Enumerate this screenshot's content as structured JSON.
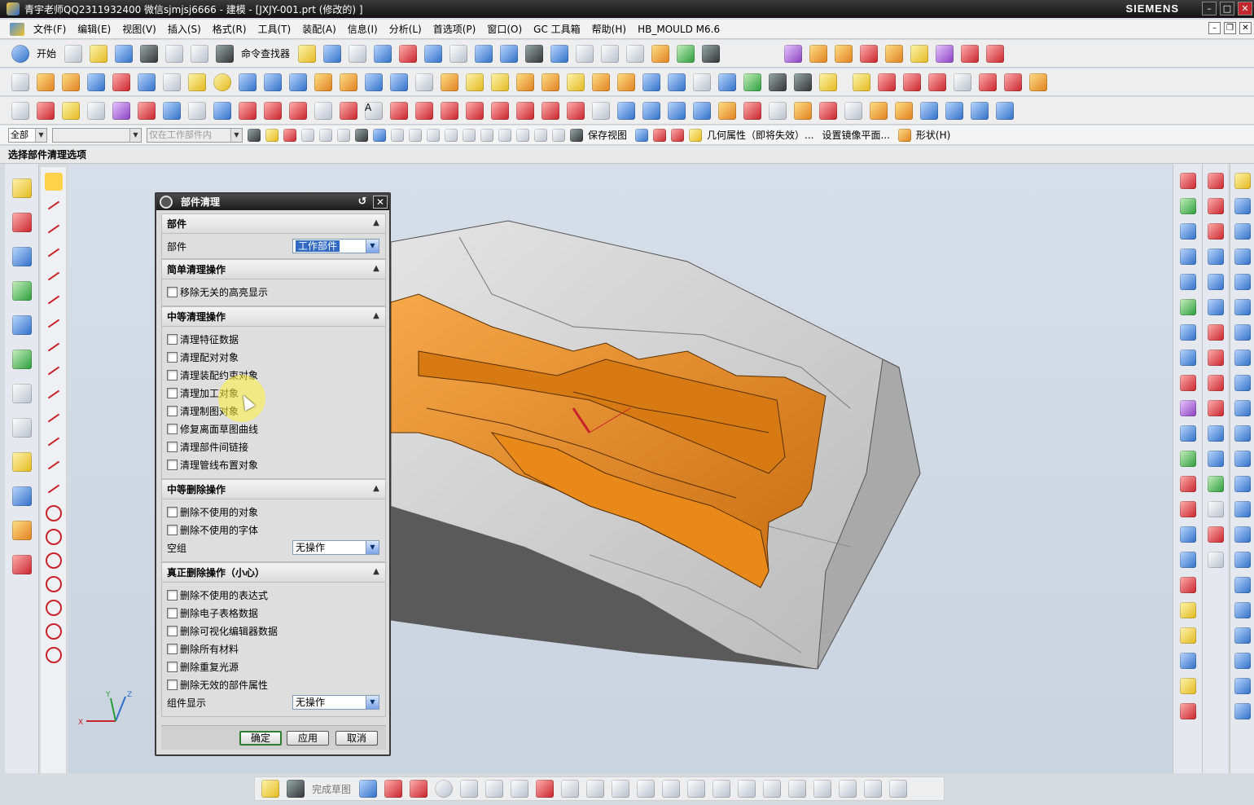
{
  "window": {
    "title": "青宇老师QQ2311932400 微信sjmjsj6666 - 建模 - [JXJY-001.prt  (修改的) ]",
    "brand": "SIEMENS",
    "minimize": "–",
    "maximize": "□",
    "close": "✕"
  },
  "menubar": {
    "items": [
      "文件(F)",
      "编辑(E)",
      "视图(V)",
      "插入(S)",
      "格式(R)",
      "工具(T)",
      "装配(A)",
      "信息(I)",
      "分析(L)",
      "首选项(P)",
      "窗口(O)",
      "GC 工具箱",
      "帮助(H)",
      "HB_MOULD M6.6"
    ]
  },
  "toolbar1": {
    "start_label": "开始",
    "command_finder_label": "命令查找器"
  },
  "toolbar4": {
    "filter_value": "全部",
    "selection_scope": "",
    "assembly_scope": "仅在工作部件内",
    "save_view_label": "保存视图",
    "geometry_props_label": "几何属性（即将失效）...",
    "mirror_plane_label": "设置镜像平面...",
    "shape_label": "形状(H)"
  },
  "status": {
    "prompt": "选择部件清理选项"
  },
  "bottom_toolbar": {
    "finish_sketch_label": "完成草图"
  },
  "dialog": {
    "title": "部件清理",
    "sections": {
      "part": {
        "header": "部件",
        "row_label": "部件",
        "dropdown_value": "工作部件"
      },
      "simple": {
        "header": "简单清理操作",
        "options": [
          "移除无关的高亮显示"
        ]
      },
      "moderate_cleanup": {
        "header": "中等清理操作",
        "options": [
          "清理特征数据",
          "清理配对对象",
          "清理装配约束对象",
          "清理加工对象",
          "清理制图对象",
          "修复离面草图曲线",
          "清理部件间链接",
          "清理管线布置对象"
        ]
      },
      "moderate_delete": {
        "header": "中等删除操作",
        "options": [
          "删除不使用的对象",
          "删除不使用的字体"
        ],
        "empty_group_label": "空组",
        "empty_group_value": "无操作"
      },
      "real_delete": {
        "header": "真正删除操作（小心）",
        "options": [
          "删除不使用的表达式",
          "删除电子表格数据",
          "删除可视化编辑器数据",
          "删除所有材料",
          "删除重复光源",
          "删除无效的部件属性"
        ],
        "component_display_label": "组件显示",
        "component_display_value": "无操作"
      }
    },
    "buttons": {
      "ok": "确定",
      "apply": "应用",
      "cancel": "取消"
    }
  },
  "triad": {
    "x_label": "X",
    "y_label": "Y",
    "z_label": "Z"
  },
  "colors": {
    "part_orange": "#e8891a",
    "mold_gray": "#c8c8c8",
    "viewport_bg": "#d2dbe6",
    "accent_red": "#c8232a"
  }
}
